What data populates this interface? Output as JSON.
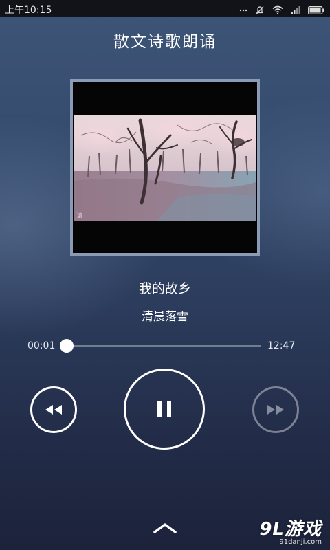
{
  "status_bar": {
    "time": "上午10:15",
    "icons": [
      "signal-icon",
      "silent-icon",
      "wifi-icon",
      "signal-bars-icon",
      "battery-icon"
    ]
  },
  "header": {
    "title": "散文诗歌朗诵"
  },
  "album": {
    "watermark": "凌"
  },
  "track": {
    "title": "我的故乡",
    "artist": "清晨落雪"
  },
  "player": {
    "elapsed": "00:01",
    "duration": "12:47",
    "progress": 0.001,
    "state": "playing"
  },
  "controls": {
    "rewind_icon": "rewind-icon",
    "pause_icon": "pause-icon",
    "forward_icon": "fast-forward-icon",
    "expand_icon": "chevron-up-icon"
  },
  "brand": {
    "logo_text": "9L游戏",
    "logo_url": "91danji.com"
  },
  "colors": {
    "background_top": "#3d5577",
    "background_bottom": "#1c223a",
    "status_bar": "#111318",
    "accent": "#ffffff"
  }
}
